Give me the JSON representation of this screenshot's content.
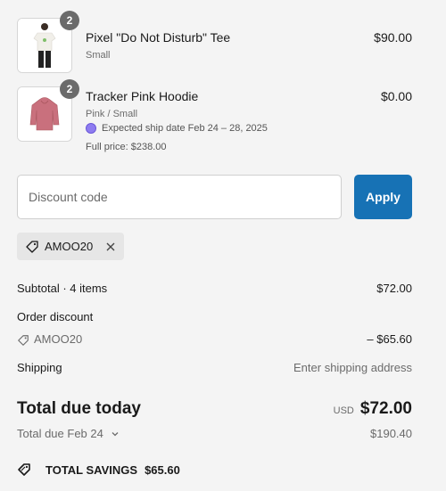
{
  "items": [
    {
      "name": "Pixel \"Do Not Disturb\" Tee",
      "variant": "Small",
      "price": "$90.00",
      "quantity": "2",
      "image_icon": "tshirt-photo"
    },
    {
      "name": "Tracker Pink Hoodie",
      "variant": "Pink / Small",
      "price": "$0.00",
      "quantity": "2",
      "ship_note": "Expected ship date Feb 24 – 28, 2025",
      "full_price": "Full price: $238.00",
      "image_icon": "hoodie-photo"
    }
  ],
  "discount": {
    "placeholder": "Discount code",
    "value": "",
    "apply_label": "Apply",
    "applied_code": "AMOO20"
  },
  "summary": {
    "subtotal_label": "Subtotal · 4 items",
    "subtotal_value": "$72.00",
    "order_discount_label": "Order discount",
    "discount_code": "AMOO20",
    "discount_value": "– $65.60",
    "shipping_label": "Shipping",
    "shipping_value": "Enter shipping address",
    "total_label": "Total due today",
    "currency": "USD",
    "total_value": "$72.00",
    "due_label": "Total due Feb 24",
    "due_value": "$190.40",
    "savings_label": "TOTAL SAVINGS",
    "savings_value": "$65.60"
  },
  "colors": {
    "accent": "#1772b5",
    "background": "#f4f4f4",
    "ship_dot": "#8e7cf0"
  }
}
